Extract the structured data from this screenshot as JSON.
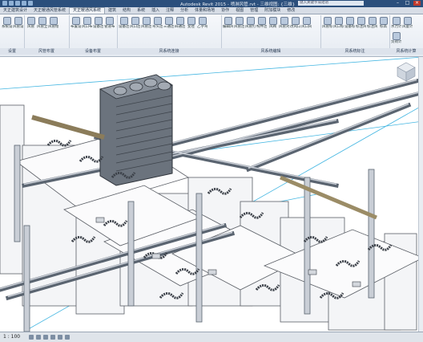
{
  "titlebar": {
    "title": "Autodesk Revit 2015 -    喷淋风管.rvt - 三维视图: {三维}",
    "search_placeholder": "键入关键字或短语"
  },
  "tabs": [
    "天正建筑设计",
    "天正暖通风管系统",
    "天正暖通风系统",
    "建筑",
    "结构",
    "系统",
    "插入",
    "注释",
    "分析",
    "体量和场地",
    "协作",
    "视图",
    "管理",
    "附加模块",
    "修改"
  ],
  "active_tab": 2,
  "ribbon": {
    "groups": [
      {
        "title": "设置",
        "buttons": [
          "系统设置",
          "风管设置"
        ]
      },
      {
        "title": "风管布置",
        "buttons": [
          "风管",
          "风管立管",
          "风管绘制"
        ]
      },
      {
        "title": "设备布置",
        "buttons": [
          "布置设备",
          "风口布置",
          "设备连接",
          "管道布置"
        ]
      },
      {
        "title": "风系统连接",
        "buttons": [
          "设备连接",
          "风口连接",
          "风管连接",
          "弯头连接",
          "三通连接",
          "四通连接",
          "变径",
          "乙字弯"
        ]
      },
      {
        "title": "风系统编辑",
        "buttons": [
          "编辑风管",
          "风管连接",
          "风管打断",
          "构件连接",
          "风阀",
          "风管对齐",
          "改风口",
          "风口间距"
        ]
      },
      {
        "title": "风系统标注",
        "buttons": [
          "风管标注",
          "风口标注",
          "设备标注",
          "标注风量",
          "标注风速",
          "标高"
        ]
      },
      {
        "title": "风系统计算",
        "buttons": [
          "水力计算",
          "风量计算",
          "负荷计算"
        ]
      }
    ]
  },
  "statusbar": {
    "scale": "1 : 100"
  },
  "colors": {
    "titlebar": "#2b4f7c",
    "duct_dark": "#5a6470",
    "duct_light": "#c9ced6",
    "panel_line": "#5b5f66",
    "grid_line": "#46b7e2"
  }
}
